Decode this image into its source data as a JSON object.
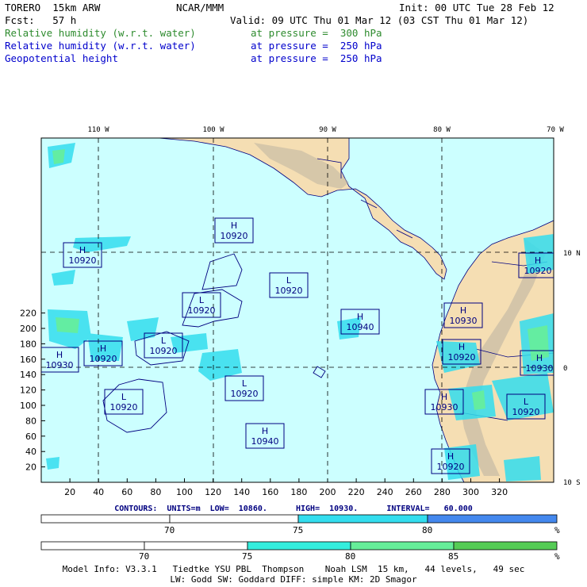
{
  "header": {
    "model": "TORERO  15km ARW",
    "org": "NCAR/MMM",
    "init": "Init: 00 UTC Tue 28 Feb 12",
    "fcst": "Fcst:   57 h",
    "valid": "Valid: 09 UTC Thu 01 Mar 12 (03 CST Thu 01 Mar 12)",
    "fields": [
      {
        "name": "Relative humidity (w.r.t. water)",
        "level": "at pressure =  300 hPa",
        "color": "#2e8b2e"
      },
      {
        "name": "Relative humidity (w.r.t. water)",
        "level": "at pressure =  250 hPa",
        "color": "#0000cc"
      },
      {
        "name": "Geopotential height",
        "level": "at pressure =  250 hPa",
        "color": "#0000cc"
      }
    ]
  },
  "map": {
    "lon_labels": [
      "110 W",
      "100 W",
      "90 W",
      "80 W",
      "70 W"
    ],
    "lat_labels": [
      "10 N",
      "0",
      "10 S"
    ],
    "x_ticks": [
      "20",
      "40",
      "60",
      "80",
      "100",
      "120",
      "140",
      "160",
      "180",
      "200",
      "220",
      "240",
      "260",
      "280",
      "300",
      "320"
    ],
    "y_ticks": [
      "20",
      "40",
      "60",
      "80",
      "100",
      "120",
      "140",
      "160",
      "180",
      "200",
      "220"
    ],
    "pressure_centers": [
      {
        "type": "H",
        "value": "10920"
      },
      {
        "type": "H",
        "value": "10920"
      },
      {
        "type": "L",
        "value": "10920"
      },
      {
        "type": "L",
        "value": "10920"
      },
      {
        "type": "H",
        "value": "10940"
      },
      {
        "type": "H",
        "value": "10920"
      },
      {
        "type": "L",
        "value": "10920"
      },
      {
        "type": "H",
        "value": "10930"
      },
      {
        "type": "L",
        "value": "10920"
      },
      {
        "type": "L",
        "value": "10920"
      },
      {
        "type": "H",
        "value": "10940"
      },
      {
        "type": "H",
        "value": "10930"
      },
      {
        "type": "H",
        "value": "10920"
      },
      {
        "type": "H",
        "value": "10930"
      },
      {
        "type": "H",
        "value": "10920"
      },
      {
        "type": "L",
        "value": "10920"
      },
      {
        "type": "H",
        "value": "10930"
      },
      {
        "type": "H",
        "value": "10920"
      }
    ],
    "colors": {
      "ocean": "#ccffff",
      "land": "#f5deb3",
      "border": "#000080",
      "grid": "#000000"
    }
  },
  "contours": {
    "text": "CONTOURS:  UNITS=m  LOW=  10860.      HIGH=  10930.      INTERVAL=   60.000"
  },
  "scale1": {
    "labels": [
      "70",
      "75",
      "80",
      "%"
    ],
    "colors": [
      "#ffffff",
      "#ffffff",
      "#33ddee",
      "#4488ee"
    ]
  },
  "scale2": {
    "labels": [
      "70",
      "75",
      "80",
      "85",
      "%"
    ],
    "colors": [
      "#ffffff",
      "#ffffff",
      "#33eedd",
      "#66ee99",
      "#55cc55"
    ]
  },
  "footer": {
    "line1": "Model Info: V3.3.1   Tiedtke YSU PBL  Thompson    Noah LSM  15 km,   44 levels,   49 sec",
    "line2": "LW: Godd SW: Goddard DIFF: simple KM: 2D Smagor"
  }
}
